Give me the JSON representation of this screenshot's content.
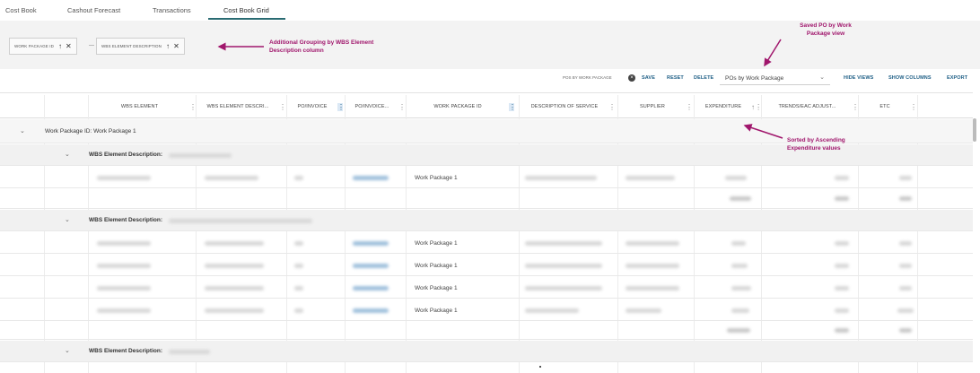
{
  "tabs": [
    "Cost Book",
    "Cashout Forecast",
    "Transactions",
    "Cost Book Grid"
  ],
  "group_chips": [
    {
      "label": "WORK PACKAGE ID"
    },
    {
      "label": "WBS ELEMENT DESCRIPTION"
    }
  ],
  "annotations": {
    "grouping": "Additional Grouping by WBS Element Description column",
    "saved_view": "Saved PO by Work Package view",
    "sorted": "Sorted by Ascending Expenditure values"
  },
  "toolbar": {
    "view_pill": "POS BY WORK PACKAGE",
    "save": "SAVE",
    "reset": "RESET",
    "delete": "DELETE",
    "selected_view": "POs by Work Package",
    "hide_views": "HIDE VIEWS",
    "show_columns": "SHOW COLUMNS",
    "export": "EXPORT"
  },
  "columns": [
    "WBS ELEMENT",
    "WBS ELEMENT DESCRI...",
    "PO/INVOICE",
    "PO/INVOICE...",
    "WORK PACKAGE ID",
    "DESCRIPTION OF SERVICE",
    "SUPPLIER",
    "EXPENDITURE",
    "TRENDS/EAC ADJUST...",
    "ETC"
  ],
  "group_level1": {
    "label": "Work Package ID:",
    "value": "Work Package 1"
  },
  "group_level2_label": "WBS Element Description:",
  "work_package_value": "Work Package 1",
  "icons": {
    "sort_ascending": "arrow-up-icon",
    "remove": "close-icon",
    "expand": "chevron-down-icon",
    "column_menu": "column-menu-icon"
  },
  "colors": {
    "accent": "#2a6b72",
    "annotation": "#a0166c",
    "toolbar_link": "#1f5f86"
  }
}
